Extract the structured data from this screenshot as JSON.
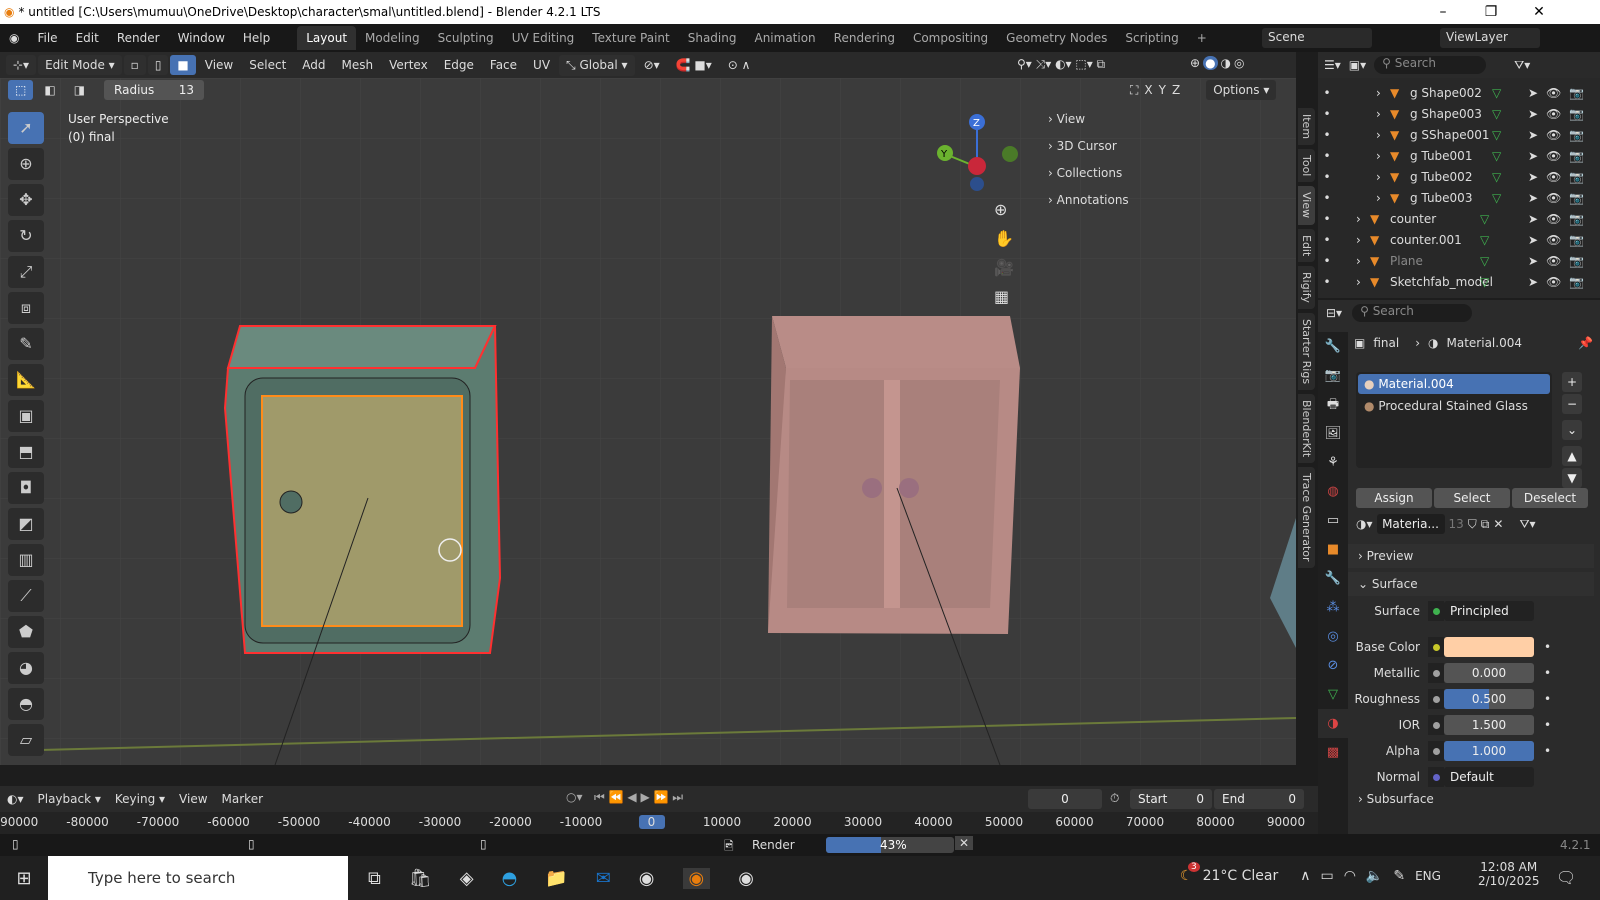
{
  "window": {
    "title": "* untitled [C:\\Users\\mumuu\\OneDrive\\Desktop\\character\\smal\\untitled.blend] - Blender 4.2.1 LTS",
    "minimize": "–",
    "maximize": "❐",
    "close": "✕"
  },
  "menubar": [
    "File",
    "Edit",
    "Render",
    "Window",
    "Help"
  ],
  "workspaces": [
    "Layout",
    "Modeling",
    "Sculpting",
    "UV Editing",
    "Texture Paint",
    "Shading",
    "Animation",
    "Rendering",
    "Compositing",
    "Geometry Nodes",
    "Scripting",
    "+"
  ],
  "active_workspace": "Layout",
  "scene": {
    "label": "Scene",
    "view_layer": "ViewLayer"
  },
  "header": {
    "mode": "Edit Mode",
    "menus": [
      "View",
      "Select",
      "Add",
      "Mesh",
      "Vertex",
      "Edge",
      "Face",
      "UV"
    ],
    "orientation": "Global",
    "options": "Options",
    "axes": [
      "X",
      "Y",
      "Z"
    ]
  },
  "tool_settings": {
    "radius_label": "Radius",
    "radius_value": "13"
  },
  "viewport": {
    "perspective": "User Perspective",
    "object": "(0) final",
    "gizmo": {
      "x": "X",
      "y": "Y",
      "z": "Z"
    }
  },
  "npanel": [
    "View",
    "3D Cursor",
    "Collections",
    "Annotations"
  ],
  "side_tabs": [
    "Item",
    "Tool",
    "View",
    "Edit",
    "Rigify",
    "Starter Rigs",
    "BlenderKit",
    "Trace Generator"
  ],
  "outliner": {
    "search_placeholder": "Search",
    "items": [
      {
        "name": "g Shape002",
        "indent": 2,
        "dim": false
      },
      {
        "name": "g Shape003",
        "indent": 2,
        "dim": false
      },
      {
        "name": "g SShape001",
        "indent": 2,
        "dim": false
      },
      {
        "name": "g Tube001",
        "indent": 2,
        "dim": false
      },
      {
        "name": "g Tube002",
        "indent": 2,
        "dim": false
      },
      {
        "name": "g Tube003",
        "indent": 2,
        "dim": false
      },
      {
        "name": "counter",
        "indent": 1,
        "dim": false
      },
      {
        "name": "counter.001",
        "indent": 1,
        "dim": false
      },
      {
        "name": "Plane",
        "indent": 1,
        "dim": true
      },
      {
        "name": "Sketchfab_model",
        "indent": 1,
        "dim": false
      }
    ]
  },
  "properties": {
    "search_placeholder": "Search",
    "breadcrumb_object": "final",
    "breadcrumb_material": "Material.004",
    "slots": [
      "Material.004",
      "Procedural Stained Glass"
    ],
    "selected_slot": 0,
    "assign": "Assign",
    "select": "Select",
    "deselect": "Deselect",
    "material_name": "Materia...",
    "users": "13",
    "preview": "Preview",
    "surface_panel": "Surface",
    "subsurface": "Subsurface",
    "fields": [
      {
        "label": "Surface",
        "value": "Principled BSDF",
        "dot": "#3fb24f",
        "fill": 0
      },
      {
        "label": "Base Color",
        "value": "",
        "dot": "#c7c729",
        "color": "#ffcfa6"
      },
      {
        "label": "Metallic",
        "value": "0.000",
        "dot": "#a0a0a0",
        "fill": 0
      },
      {
        "label": "Roughness",
        "value": "0.500",
        "dot": "#a0a0a0",
        "fill": 0.5
      },
      {
        "label": "IOR",
        "value": "1.500",
        "dot": "#a0a0a0",
        "fill": 0
      },
      {
        "label": "Alpha",
        "value": "1.000",
        "dot": "#a0a0a0",
        "fill": 1
      },
      {
        "label": "Normal",
        "value": "Default",
        "dot": "#6363c7",
        "fill": 0
      }
    ]
  },
  "timeline": {
    "menus": [
      "Playback",
      "Keying",
      "View",
      "Marker"
    ],
    "current_frame": "0",
    "start_label": "Start",
    "start": "0",
    "end_label": "End",
    "end": "0",
    "ticks": [
      "-90000",
      "-80000",
      "-70000",
      "-60000",
      "-50000",
      "-40000",
      "-30000",
      "-20000",
      "-10000",
      "0",
      "10000",
      "20000",
      "30000",
      "40000",
      "50000",
      "60000",
      "70000",
      "80000",
      "90000"
    ]
  },
  "status": {
    "job": "Render",
    "progress_text": "43%",
    "progress": 0.43,
    "version": "4.2.1"
  },
  "taskbar": {
    "search_placeholder": "Type here to search",
    "weather": "21°C  Clear",
    "badge": "3",
    "lang": "ENG",
    "time": "12:08 AM",
    "date": "2/10/2025"
  },
  "colors": {
    "accent": "#4772b3",
    "selection": "#ff8c1a",
    "cabinet_right": "#b78a85",
    "cabinet_left": "#a29a6c"
  }
}
